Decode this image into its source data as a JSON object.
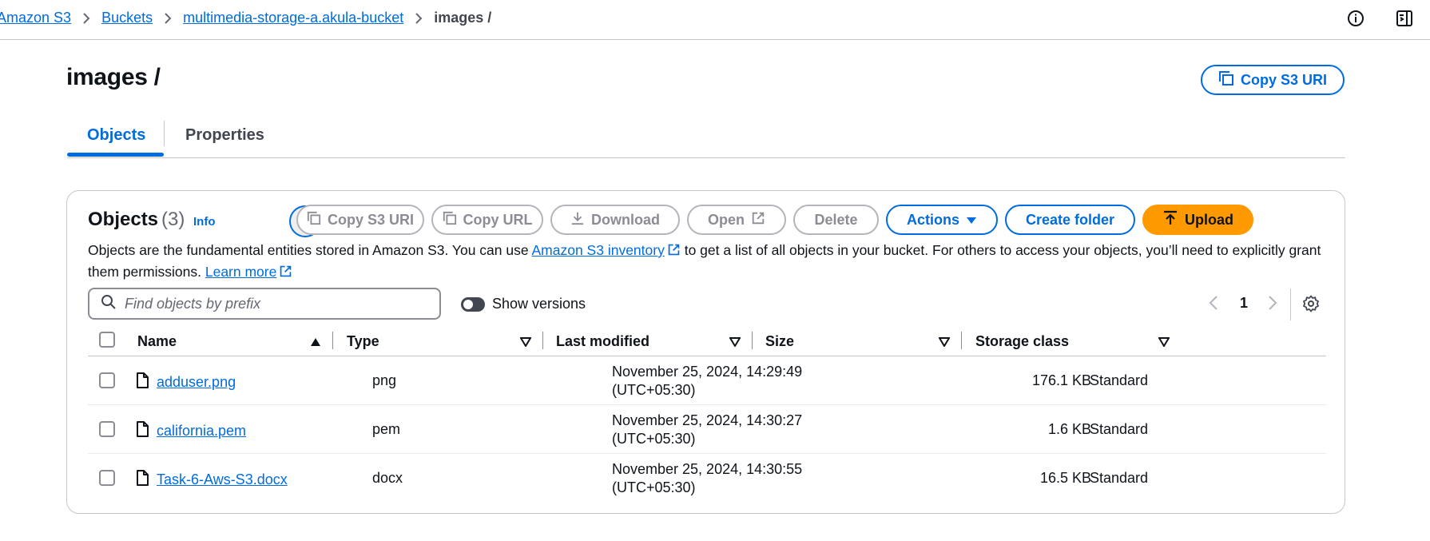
{
  "breadcrumb": {
    "items": [
      "Amazon S3",
      "Buckets",
      "multimedia-storage-a.akula-bucket"
    ],
    "current": "images /"
  },
  "header": {
    "title": "images /",
    "copy_uri_label": "Copy S3 URI"
  },
  "tabs": [
    {
      "label": "Objects",
      "active": true
    },
    {
      "label": "Properties",
      "active": false
    }
  ],
  "objects_panel": {
    "heading": "Objects",
    "count": "(3)",
    "info": "Info",
    "toolbar": {
      "copy_s3_uri": "Copy S3 URI",
      "copy_url": "Copy URL",
      "download": "Download",
      "open": "Open",
      "delete": "Delete",
      "actions": "Actions",
      "create_folder": "Create folder",
      "upload": "Upload"
    },
    "description": {
      "part1": "Objects are the fundamental entities stored in Amazon S3. You can use ",
      "inventory_link": "Amazon S3 inventory",
      "part2": " to get a list of all objects in your bucket. For others to access your objects, you’ll need to explicitly grant them permissions. ",
      "learn_more": "Learn more"
    },
    "search": {
      "placeholder": "Find objects by prefix",
      "value": ""
    },
    "show_versions": {
      "label": "Show versions",
      "enabled": false
    },
    "pagination": {
      "page": "1"
    }
  },
  "table": {
    "columns": [
      "Name",
      "Type",
      "Last modified",
      "Size",
      "Storage class"
    ],
    "rows": [
      {
        "name": "adduser.png",
        "type": "png",
        "modified_date": "November 25, 2024, 14:29:49",
        "modified_tz": "(UTC+05:30)",
        "size": "176.1 KB",
        "storage_class": "Standard"
      },
      {
        "name": "california.pem",
        "type": "pem",
        "modified_date": "November 25, 2024, 14:30:27",
        "modified_tz": "(UTC+05:30)",
        "size": "1.6 KB",
        "storage_class": "Standard"
      },
      {
        "name": "Task-6-Aws-S3.docx",
        "type": "docx",
        "modified_date": "November 25, 2024, 14:30:55",
        "modified_tz": "(UTC+05:30)",
        "size": "16.5 KB",
        "storage_class": "Standard"
      }
    ]
  },
  "colors": {
    "link": "#006ce0",
    "primary": "#ff9900",
    "border": "#c6c6cd",
    "text": "#0f141a"
  }
}
